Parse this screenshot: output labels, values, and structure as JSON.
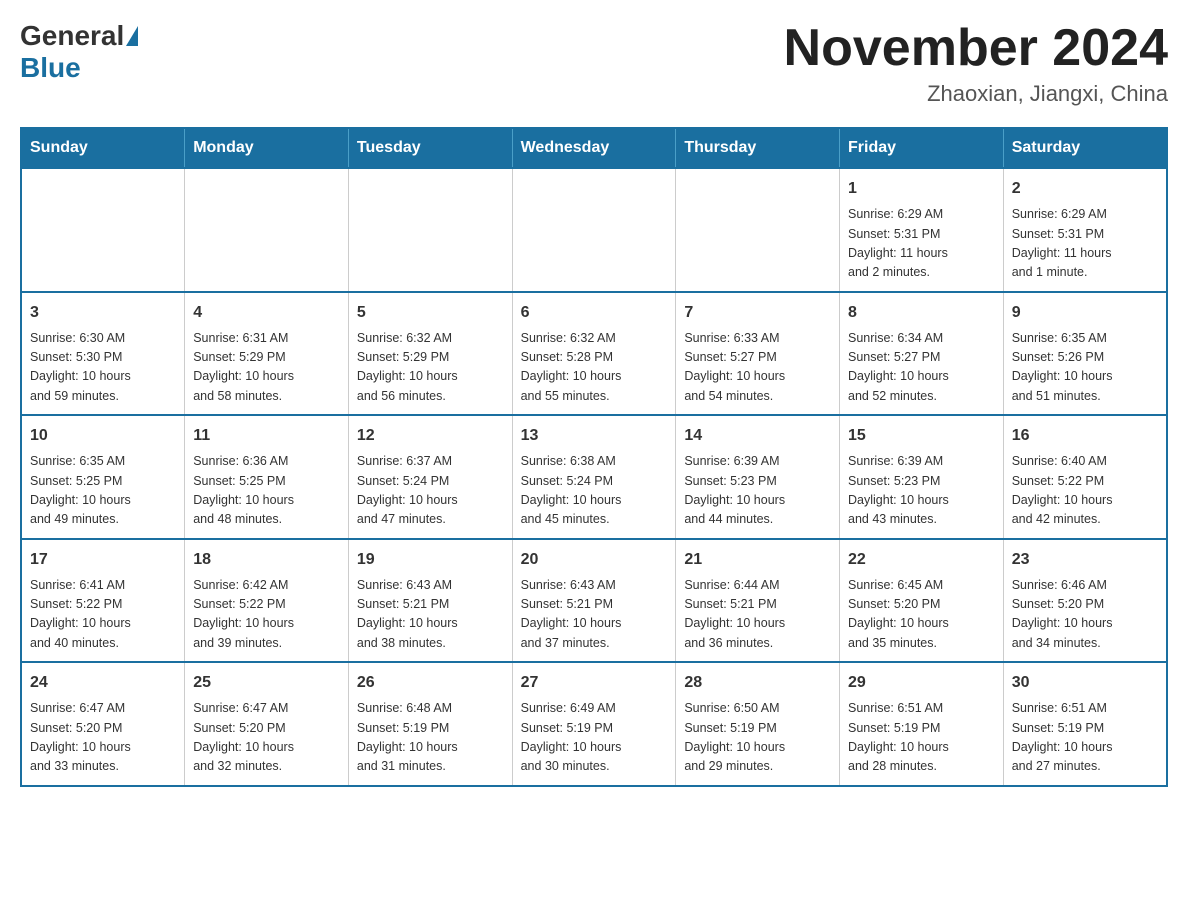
{
  "header": {
    "logo_general": "General",
    "logo_blue": "Blue",
    "month_title": "November 2024",
    "location": "Zhaoxian, Jiangxi, China"
  },
  "weekdays": [
    "Sunday",
    "Monday",
    "Tuesday",
    "Wednesday",
    "Thursday",
    "Friday",
    "Saturday"
  ],
  "weeks": [
    {
      "days": [
        {
          "date": "",
          "info": ""
        },
        {
          "date": "",
          "info": ""
        },
        {
          "date": "",
          "info": ""
        },
        {
          "date": "",
          "info": ""
        },
        {
          "date": "",
          "info": ""
        },
        {
          "date": "1",
          "info": "Sunrise: 6:29 AM\nSunset: 5:31 PM\nDaylight: 11 hours\nand 2 minutes."
        },
        {
          "date": "2",
          "info": "Sunrise: 6:29 AM\nSunset: 5:31 PM\nDaylight: 11 hours\nand 1 minute."
        }
      ]
    },
    {
      "days": [
        {
          "date": "3",
          "info": "Sunrise: 6:30 AM\nSunset: 5:30 PM\nDaylight: 10 hours\nand 59 minutes."
        },
        {
          "date": "4",
          "info": "Sunrise: 6:31 AM\nSunset: 5:29 PM\nDaylight: 10 hours\nand 58 minutes."
        },
        {
          "date": "5",
          "info": "Sunrise: 6:32 AM\nSunset: 5:29 PM\nDaylight: 10 hours\nand 56 minutes."
        },
        {
          "date": "6",
          "info": "Sunrise: 6:32 AM\nSunset: 5:28 PM\nDaylight: 10 hours\nand 55 minutes."
        },
        {
          "date": "7",
          "info": "Sunrise: 6:33 AM\nSunset: 5:27 PM\nDaylight: 10 hours\nand 54 minutes."
        },
        {
          "date": "8",
          "info": "Sunrise: 6:34 AM\nSunset: 5:27 PM\nDaylight: 10 hours\nand 52 minutes."
        },
        {
          "date": "9",
          "info": "Sunrise: 6:35 AM\nSunset: 5:26 PM\nDaylight: 10 hours\nand 51 minutes."
        }
      ]
    },
    {
      "days": [
        {
          "date": "10",
          "info": "Sunrise: 6:35 AM\nSunset: 5:25 PM\nDaylight: 10 hours\nand 49 minutes."
        },
        {
          "date": "11",
          "info": "Sunrise: 6:36 AM\nSunset: 5:25 PM\nDaylight: 10 hours\nand 48 minutes."
        },
        {
          "date": "12",
          "info": "Sunrise: 6:37 AM\nSunset: 5:24 PM\nDaylight: 10 hours\nand 47 minutes."
        },
        {
          "date": "13",
          "info": "Sunrise: 6:38 AM\nSunset: 5:24 PM\nDaylight: 10 hours\nand 45 minutes."
        },
        {
          "date": "14",
          "info": "Sunrise: 6:39 AM\nSunset: 5:23 PM\nDaylight: 10 hours\nand 44 minutes."
        },
        {
          "date": "15",
          "info": "Sunrise: 6:39 AM\nSunset: 5:23 PM\nDaylight: 10 hours\nand 43 minutes."
        },
        {
          "date": "16",
          "info": "Sunrise: 6:40 AM\nSunset: 5:22 PM\nDaylight: 10 hours\nand 42 minutes."
        }
      ]
    },
    {
      "days": [
        {
          "date": "17",
          "info": "Sunrise: 6:41 AM\nSunset: 5:22 PM\nDaylight: 10 hours\nand 40 minutes."
        },
        {
          "date": "18",
          "info": "Sunrise: 6:42 AM\nSunset: 5:22 PM\nDaylight: 10 hours\nand 39 minutes."
        },
        {
          "date": "19",
          "info": "Sunrise: 6:43 AM\nSunset: 5:21 PM\nDaylight: 10 hours\nand 38 minutes."
        },
        {
          "date": "20",
          "info": "Sunrise: 6:43 AM\nSunset: 5:21 PM\nDaylight: 10 hours\nand 37 minutes."
        },
        {
          "date": "21",
          "info": "Sunrise: 6:44 AM\nSunset: 5:21 PM\nDaylight: 10 hours\nand 36 minutes."
        },
        {
          "date": "22",
          "info": "Sunrise: 6:45 AM\nSunset: 5:20 PM\nDaylight: 10 hours\nand 35 minutes."
        },
        {
          "date": "23",
          "info": "Sunrise: 6:46 AM\nSunset: 5:20 PM\nDaylight: 10 hours\nand 34 minutes."
        }
      ]
    },
    {
      "days": [
        {
          "date": "24",
          "info": "Sunrise: 6:47 AM\nSunset: 5:20 PM\nDaylight: 10 hours\nand 33 minutes."
        },
        {
          "date": "25",
          "info": "Sunrise: 6:47 AM\nSunset: 5:20 PM\nDaylight: 10 hours\nand 32 minutes."
        },
        {
          "date": "26",
          "info": "Sunrise: 6:48 AM\nSunset: 5:19 PM\nDaylight: 10 hours\nand 31 minutes."
        },
        {
          "date": "27",
          "info": "Sunrise: 6:49 AM\nSunset: 5:19 PM\nDaylight: 10 hours\nand 30 minutes."
        },
        {
          "date": "28",
          "info": "Sunrise: 6:50 AM\nSunset: 5:19 PM\nDaylight: 10 hours\nand 29 minutes."
        },
        {
          "date": "29",
          "info": "Sunrise: 6:51 AM\nSunset: 5:19 PM\nDaylight: 10 hours\nand 28 minutes."
        },
        {
          "date": "30",
          "info": "Sunrise: 6:51 AM\nSunset: 5:19 PM\nDaylight: 10 hours\nand 27 minutes."
        }
      ]
    }
  ]
}
